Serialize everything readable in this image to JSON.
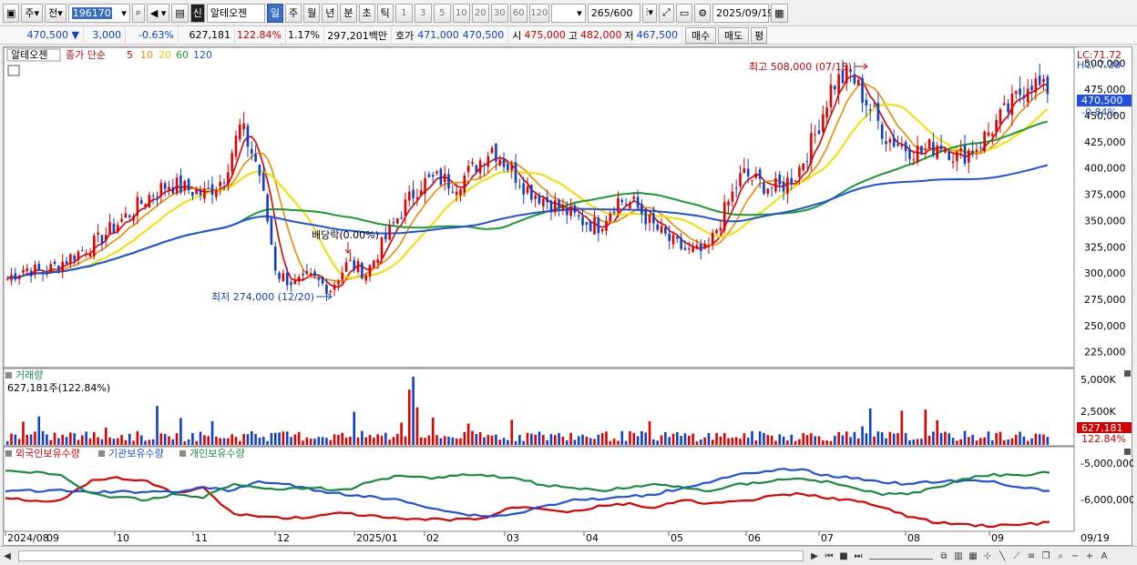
{
  "toolbar": {
    "period_main": "주",
    "stock_type": "전",
    "stock_code": "196170",
    "credit_badge": "신",
    "stock_name": "알테오젠",
    "periods": [
      "일",
      "주",
      "월",
      "년",
      "분",
      "초",
      "틱"
    ],
    "selected_period": "일",
    "numbers": [
      "1",
      "3",
      "5",
      "10",
      "20",
      "30",
      "60",
      "120"
    ],
    "count": "265",
    "count_max": "/600",
    "date": "2025/09/19"
  },
  "quote": {
    "price": "470,500",
    "change_arrow": "▼",
    "change": "3,000",
    "change_pct": "-0.63%",
    "volume": "627,181",
    "volume_ratio": "122.84%",
    "turnover": "1.17%",
    "amount": "297,201백만",
    "ask_label": "호가",
    "ask1": "471,000",
    "ask2": "470,500",
    "open_label": "시",
    "open": "475,000",
    "high_label": "고",
    "high": "482,000",
    "low_label": "저",
    "low": "467,500",
    "buy_button": "매수",
    "sell_button": "매도",
    "eval_button": "평"
  },
  "legend": {
    "stock_name": "알테오젠",
    "ma_title": "종가 단순",
    "ma_periods": [
      "5",
      "10",
      "20",
      "60",
      "120"
    ],
    "ma_colors": [
      "#e00000",
      "#f08a00",
      "#f0e000",
      "#1a9a30",
      "#2050e0"
    ],
    "lc": "LC:71.72",
    "hc": "HC:-7.38"
  },
  "price_axis": {
    "ticks": [
      "500,000",
      "475,000",
      "450,000",
      "425,000",
      "400,000",
      "375,000",
      "350,000",
      "325,000",
      "300,000",
      "275,000",
      "250,000",
      "225,000"
    ],
    "current_label": "470,500",
    "current_pct": "-0.84%"
  },
  "annotations": {
    "high": "최고 508,000 (07/18)",
    "low": "최저 274,000 (12/20)",
    "dividend": "배당락(0.00%)"
  },
  "volume_panel": {
    "title": "거래량",
    "readout": "627,181주(122.84%)",
    "ticks": [
      "5,000K",
      "2,500K"
    ],
    "current_label": "627,181",
    "current_pct": "122.84%"
  },
  "holdings_panel": {
    "series_names": [
      "외국인보유수량",
      "기관보유수량",
      "개인보유수량"
    ],
    "series_colors": [
      "#e00000",
      "#2050e0",
      "#1a8a40"
    ],
    "ticks": [
      "-5,000,000",
      "-6,000,000"
    ]
  },
  "x_axis": {
    "labels": [
      "2024/08",
      "09",
      "10",
      "11",
      "12",
      "2025/01",
      "02",
      "03",
      "04",
      "05",
      "06",
      "07",
      "08",
      "09"
    ],
    "end_label": "09/19"
  },
  "chart_data": {
    "type": "line",
    "title": "",
    "ylim": [
      210000,
      515000
    ],
    "ma_periods": [
      5,
      10,
      20,
      60,
      120
    ],
    "closes_approx": [
      295000,
      305000,
      300000,
      310000,
      320000,
      330000,
      345000,
      360000,
      375000,
      385000,
      380000,
      375000,
      390000,
      440000,
      400000,
      300000,
      290000,
      295000,
      285000,
      310000,
      300000,
      330000,
      360000,
      385000,
      390000,
      385000,
      400000,
      420000,
      400000,
      380000,
      370000,
      360000,
      350000,
      345000,
      370000,
      365000,
      345000,
      330000,
      320000,
      320000,
      360000,
      395000,
      385000,
      380000,
      395000,
      430000,
      480000,
      490000,
      460000,
      430000,
      420000,
      415000,
      425000,
      410000,
      420000,
      440000,
      460000,
      485000,
      470500
    ],
    "volume_max_k": 5800
  }
}
